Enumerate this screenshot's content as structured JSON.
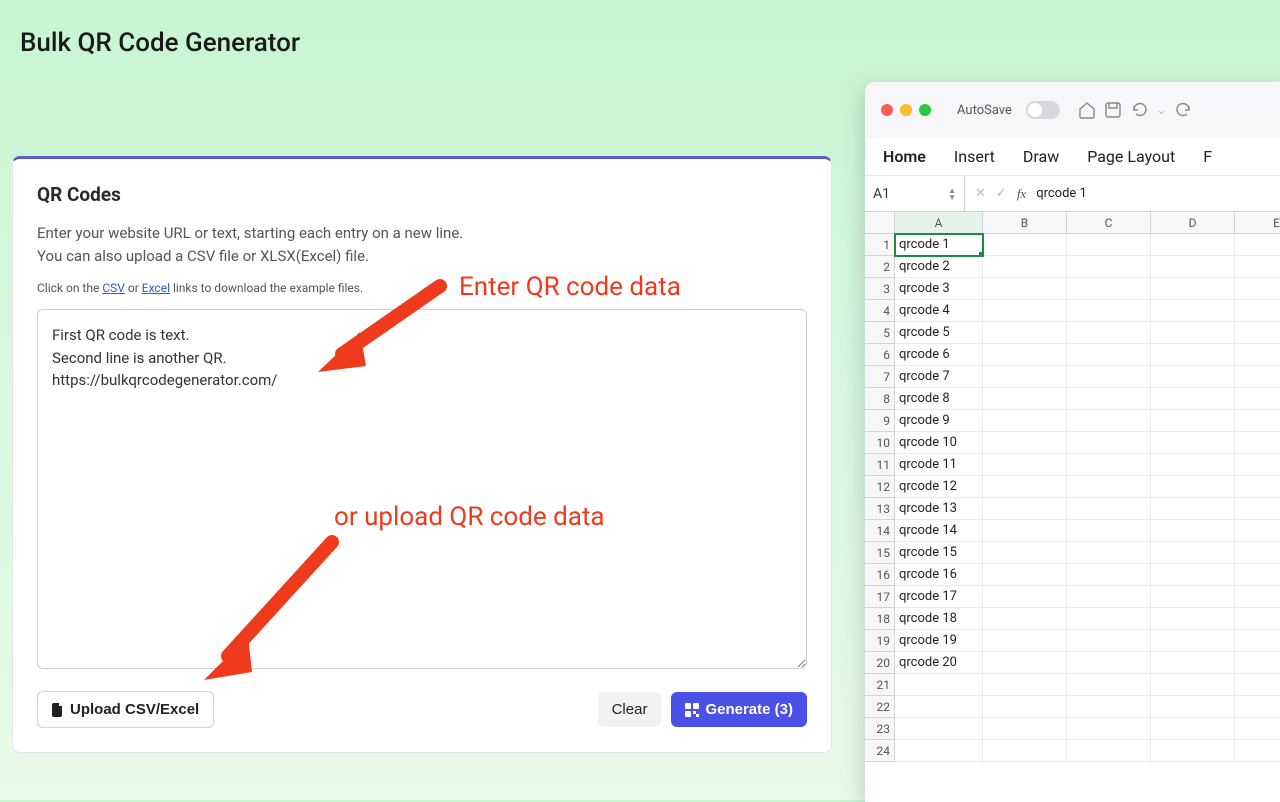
{
  "header": {
    "title": "Bulk QR Code Generator"
  },
  "card": {
    "title": "QR Codes",
    "desc_line1": "Enter your website URL or text, starting each entry on a new line.",
    "desc_line2": "You can also upload a CSV file or XLSX(Excel) file.",
    "hint_prefix": "Click on the ",
    "hint_csv": "CSV",
    "hint_mid": " or ",
    "hint_excel": "Excel",
    "hint_suffix": " links to download the example files.",
    "textarea_value": "First QR code is text.\nSecond line is another QR.\nhttps://bulkqrcodegenerator.com/",
    "upload_label": "Upload CSV/Excel",
    "clear_label": "Clear",
    "generate_label": "Generate (3)"
  },
  "annotations": {
    "enter": "Enter QR code data",
    "upload": "or upload QR code data"
  },
  "excel": {
    "autosave": "AutoSave",
    "tabs": {
      "home": "Home",
      "insert": "Insert",
      "draw": "Draw",
      "page_layout": "Page Layout",
      "formulas_initial": "F"
    },
    "cell_ref": "A1",
    "fx_label": "fx",
    "fx_value": "qrcode 1",
    "columns": [
      "A",
      "B",
      "C",
      "D",
      "E"
    ],
    "rows": [
      "qrcode 1",
      "qrcode 2",
      "qrcode 3",
      "qrcode 4",
      "qrcode 5",
      "qrcode 6",
      "qrcode 7",
      "qrcode 8",
      "qrcode 9",
      "qrcode 10",
      "qrcode 11",
      "qrcode 12",
      "qrcode 13",
      "qrcode 14",
      "qrcode 15",
      "qrcode 16",
      "qrcode 17",
      "qrcode 18",
      "qrcode 19",
      "qrcode 20",
      "",
      "",
      "",
      ""
    ]
  }
}
